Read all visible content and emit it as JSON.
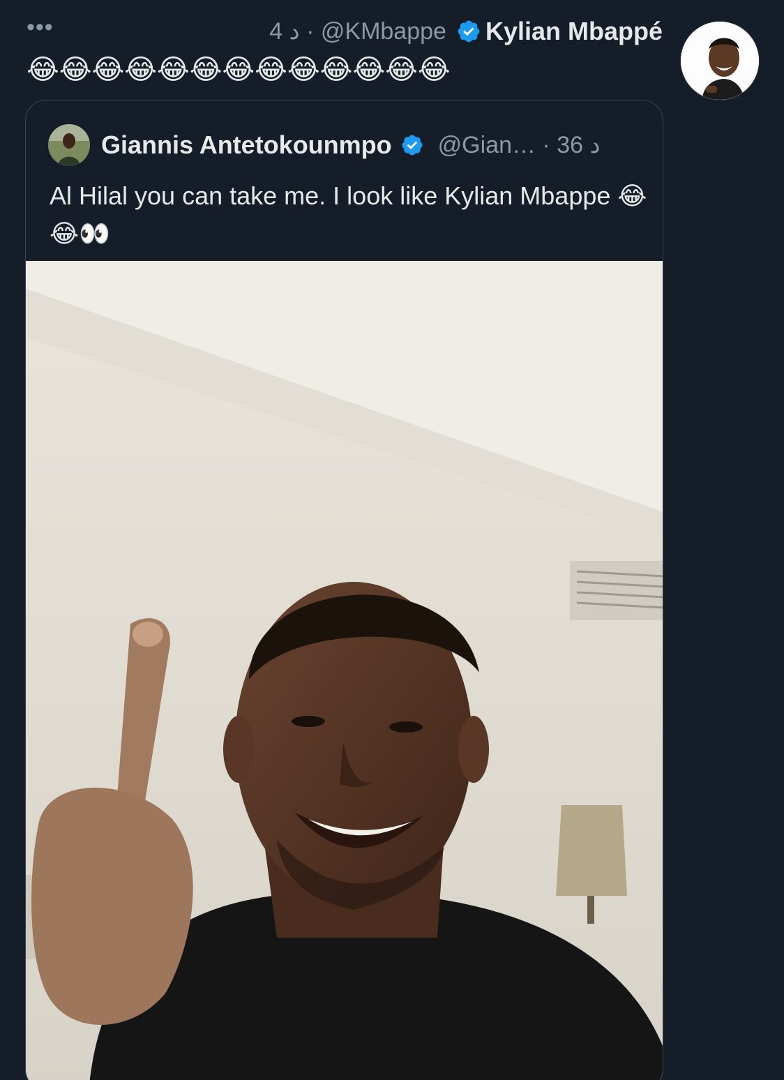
{
  "tweet": {
    "more_label": "•••",
    "meta": "4 د · @KMbappe",
    "author_name": "Kylian Mbappé",
    "text": "😂😂😂😂😂😂😂😂😂😂😂😂😂",
    "avatar_icon": "profile-photo",
    "verified_color": "#1d9bf0"
  },
  "quote": {
    "author_name": "Giannis Antetokounmpo",
    "meta": "@Gian… · 36 د",
    "text": "Al Hilal you can take me. I look like Kylian Mbappe 😂😂👀",
    "avatar_icon": "profile-photo",
    "media_icon": "selfie-photo"
  },
  "colors": {
    "background": "#151d28",
    "text_primary": "#e7e9ea",
    "text_secondary": "#8b98a5",
    "border": "#3a4450",
    "accent": "#1d9bf0"
  }
}
